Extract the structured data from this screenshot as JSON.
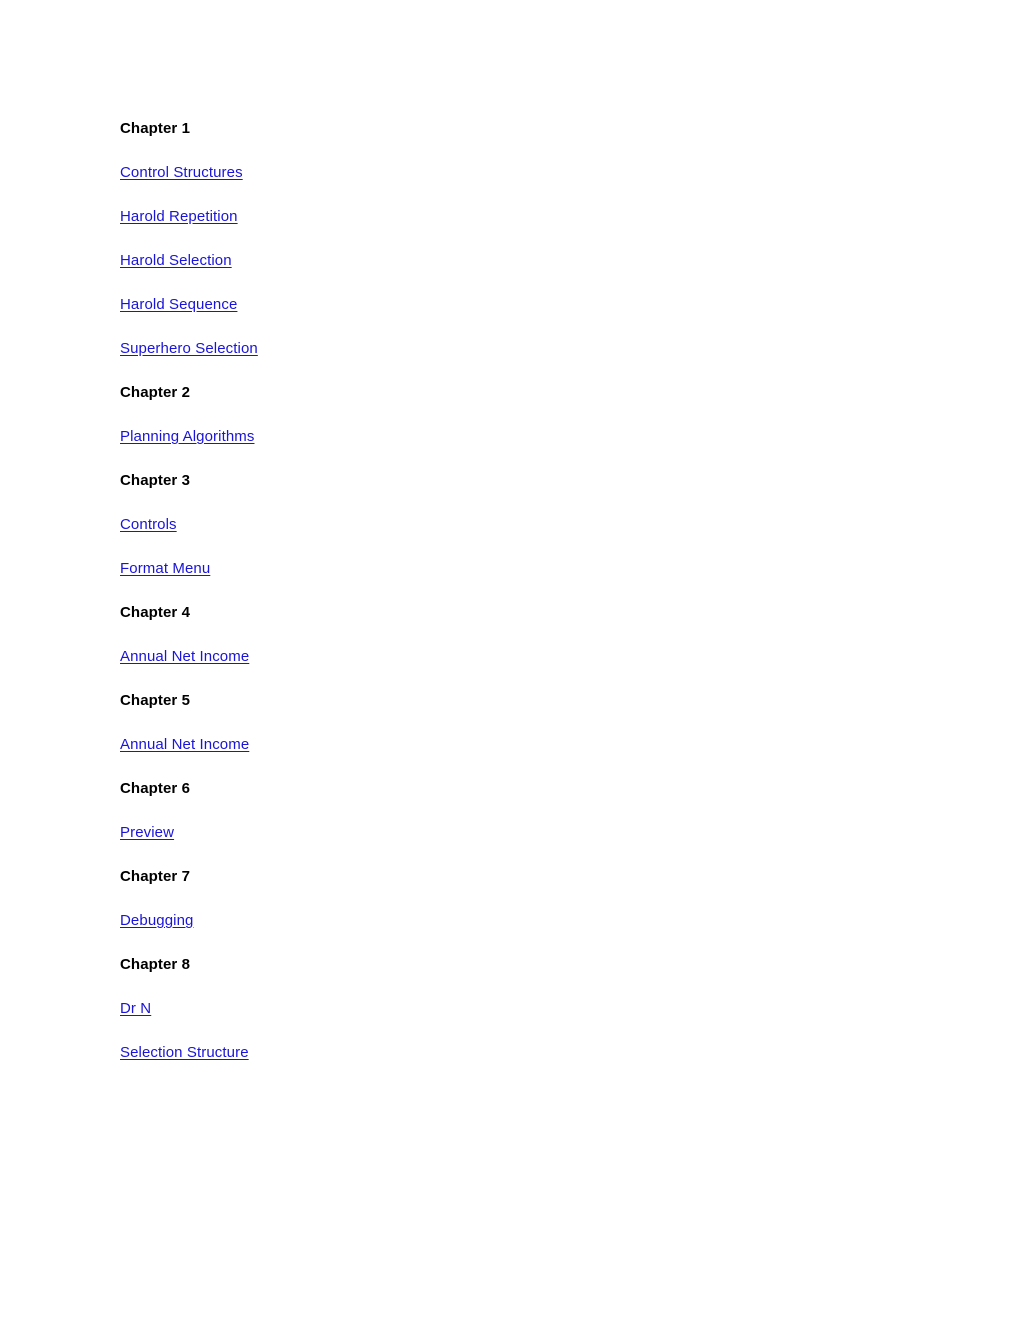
{
  "document": {
    "background_color": "#ffffff",
    "link_color": "#1a14d8",
    "heading_color": "#000000"
  },
  "toc": {
    "groups": [
      {
        "heading": "Chapter 1",
        "tight": false,
        "entries": [
          {
            "label": "Control Structures"
          },
          {
            "label": "Harold Repetition"
          },
          {
            "label": "Harold Selection"
          },
          {
            "label": "Harold Sequence"
          },
          {
            "label": "Superhero Selection"
          }
        ]
      },
      {
        "heading": "Chapter 2",
        "tight": false,
        "entries": [
          {
            "label": "Planning Algorithms"
          }
        ]
      },
      {
        "heading": "Chapter 3",
        "tight": false,
        "entries": [
          {
            "label": "Controls"
          },
          {
            "label": "Format Menu"
          }
        ]
      },
      {
        "heading": "Chapter 4",
        "tight": false,
        "entries": [
          {
            "label": "Annual Net Income"
          }
        ]
      },
      {
        "heading": "Chapter 5",
        "tight": true,
        "entries": [
          {
            "label": "Annual Net Income"
          }
        ]
      },
      {
        "heading": "Chapter 6",
        "tight": false,
        "entries": [
          {
            "label": "Preview"
          }
        ]
      },
      {
        "heading": "Chapter 7",
        "tight": false,
        "entries": [
          {
            "label": "Debugging"
          }
        ]
      },
      {
        "heading": "Chapter 8",
        "tight": false,
        "entries": [
          {
            "label": "Dr N"
          },
          {
            "label": "Selection Structure"
          }
        ]
      }
    ]
  }
}
